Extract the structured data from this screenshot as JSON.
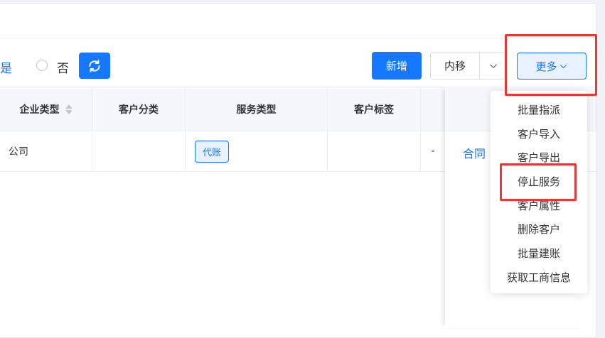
{
  "filter": {
    "yes_label": "是",
    "no_label": "否"
  },
  "toolbar": {
    "add_label": "新增",
    "move_in_label": "内移",
    "more_label": "更多"
  },
  "table": {
    "columns": [
      "企业类型",
      "客户分类",
      "服务类型",
      "客户标签"
    ],
    "rows": [
      {
        "enterprise_type": "公司",
        "customer_category": "",
        "service_tag": "代账",
        "customer_tag": "",
        "extra": "-",
        "action_link": "合同"
      }
    ]
  },
  "dropdown": {
    "items": [
      "批量指派",
      "客户导入",
      "客户导出",
      "停止服务",
      "客户属性",
      "删除客户",
      "批量建账",
      "获取工商信息"
    ]
  },
  "colors": {
    "primary": "#1677ff",
    "highlight": "#e53935"
  }
}
